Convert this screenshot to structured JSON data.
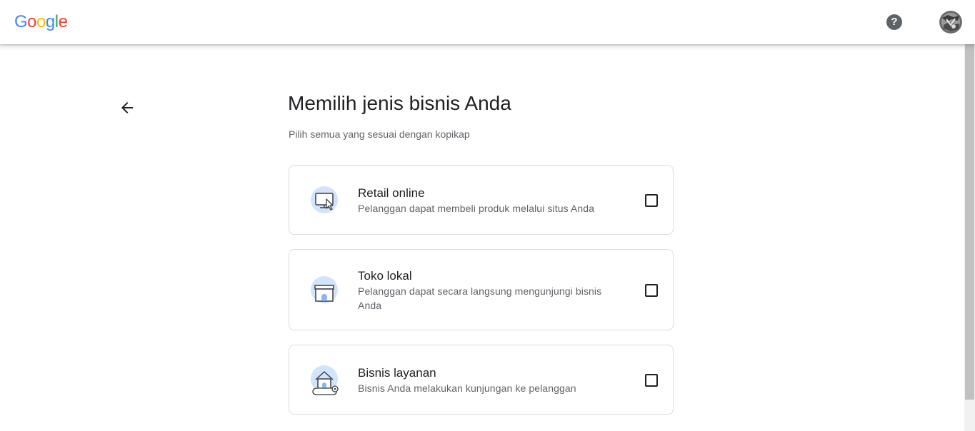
{
  "header": {
    "logo_letters": [
      {
        "char": "G",
        "color": "#4285F4"
      },
      {
        "char": "o",
        "color": "#EA4335"
      },
      {
        "char": "o",
        "color": "#FBBC05"
      },
      {
        "char": "g",
        "color": "#4285F4"
      },
      {
        "char": "l",
        "color": "#34A853"
      },
      {
        "char": "e",
        "color": "#EA4335"
      }
    ],
    "help_icon": "help-icon",
    "help_glyph": "?",
    "avatar_icon": "avatar"
  },
  "main": {
    "back_icon": "arrow-left-icon",
    "title": "Memilih jenis bisnis Anda",
    "subtitle": "Pilih semua yang sesuai dengan kopikap",
    "options": [
      {
        "icon": "monitor-cursor-icon",
        "title": "Retail online",
        "description": "Pelanggan dapat membeli produk melalui situs Anda",
        "checked": false
      },
      {
        "icon": "storefront-icon",
        "title": "Toko lokal",
        "description": "Pelanggan dapat secara langsung mengunjungi bisnis Anda",
        "checked": false
      },
      {
        "icon": "home-location-icon",
        "title": "Bisnis layanan",
        "description": "Bisnis Anda melakukan kunjungan ke pelanggan",
        "checked": false
      }
    ]
  },
  "colors": {
    "accent_light": "#d2e3fc",
    "accent": "#8ab4f8",
    "text_primary": "#202124",
    "text_secondary": "#5f6368",
    "border": "#dadce0"
  }
}
